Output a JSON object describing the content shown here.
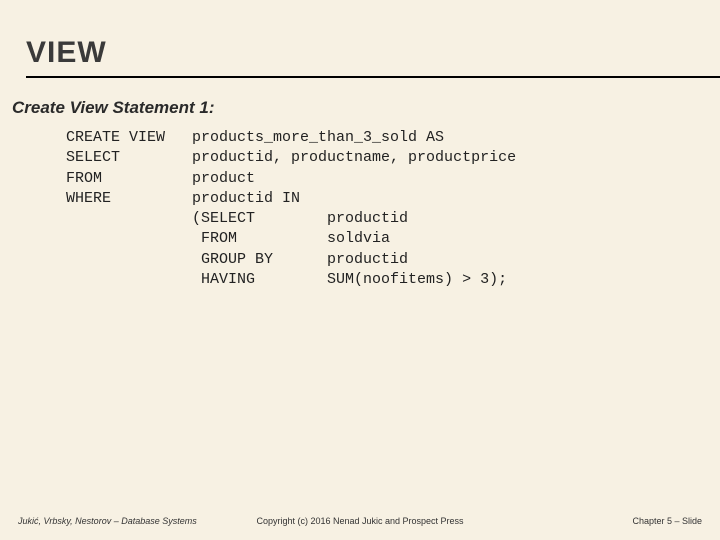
{
  "title": "VIEW",
  "subtitle": "Create View Statement 1:",
  "code": "CREATE VIEW   products_more_than_3_sold AS\nSELECT        productid, productname, productprice\nFROM          product\nWHERE         productid IN\n              (SELECT        productid\n               FROM          soldvia\n               GROUP BY      productid\n               HAVING        SUM(noofitems) > 3);",
  "footer": {
    "left": "Jukić, Vrbsky, Nestorov – Database Systems",
    "center": "Copyright (c) 2016 Nenad Jukic and Prospect Press",
    "right": "Chapter 5 – Slide"
  }
}
